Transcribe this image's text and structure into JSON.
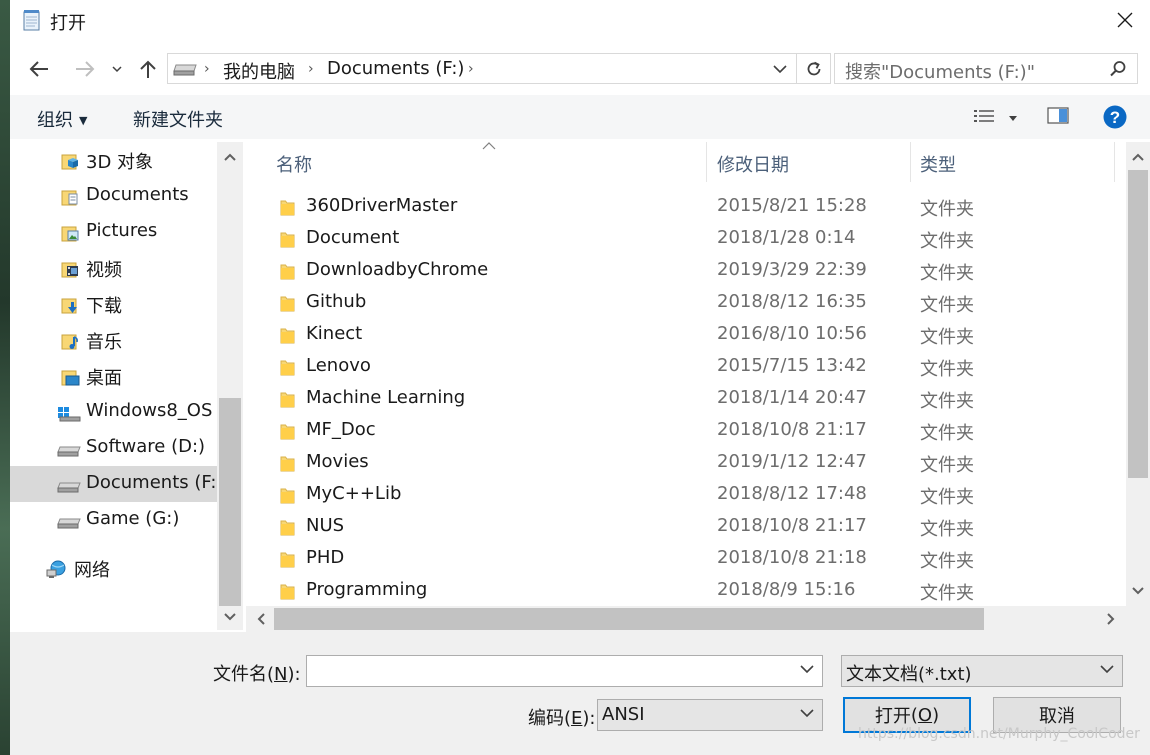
{
  "window": {
    "title": "打开"
  },
  "address": {
    "crumbs": [
      "我的电脑",
      "Documents (F:)"
    ],
    "search_placeholder": "搜索\"Documents (F:)\""
  },
  "toolbar": {
    "organize": "组织",
    "new_folder": "新建文件夹"
  },
  "nav": {
    "items": [
      {
        "label": "3D 对象",
        "icon": "3d-objects-icon"
      },
      {
        "label": "Documents",
        "icon": "documents-folder-icon"
      },
      {
        "label": "Pictures",
        "icon": "pictures-folder-icon"
      },
      {
        "label": "视频",
        "icon": "videos-folder-icon"
      },
      {
        "label": "下载",
        "icon": "downloads-folder-icon"
      },
      {
        "label": "音乐",
        "icon": "music-folder-icon"
      },
      {
        "label": "桌面",
        "icon": "desktop-folder-icon"
      },
      {
        "label": "Windows8_OS (",
        "icon": "windows-drive-icon"
      },
      {
        "label": "Software (D:)",
        "icon": "drive-icon"
      },
      {
        "label": "Documents (F:)",
        "icon": "drive-icon",
        "selected": true
      },
      {
        "label": "Game (G:)",
        "icon": "drive-icon"
      },
      {
        "label": "网络",
        "icon": "network-icon"
      }
    ]
  },
  "columns": {
    "name": "名称",
    "modified": "修改日期",
    "type": "类型"
  },
  "files": [
    {
      "name": "360DriverMaster",
      "date": "2015/8/21 15:28",
      "type": "文件夹"
    },
    {
      "name": "Document",
      "date": "2018/1/28 0:14",
      "type": "文件夹"
    },
    {
      "name": "DownloadbyChrome",
      "date": "2019/3/29 22:39",
      "type": "文件夹"
    },
    {
      "name": "Github",
      "date": "2018/8/12 16:35",
      "type": "文件夹"
    },
    {
      "name": "Kinect",
      "date": "2016/8/10 10:56",
      "type": "文件夹"
    },
    {
      "name": "Lenovo",
      "date": "2015/7/15 13:42",
      "type": "文件夹"
    },
    {
      "name": "Machine Learning",
      "date": "2018/1/14 20:47",
      "type": "文件夹"
    },
    {
      "name": "MF_Doc",
      "date": "2018/10/8 21:17",
      "type": "文件夹"
    },
    {
      "name": "Movies",
      "date": "2019/1/12 12:47",
      "type": "文件夹"
    },
    {
      "name": "MyC++Lib",
      "date": "2018/8/12 17:48",
      "type": "文件夹"
    },
    {
      "name": "NUS",
      "date": "2018/10/8 21:17",
      "type": "文件夹"
    },
    {
      "name": "PHD",
      "date": "2018/10/8 21:18",
      "type": "文件夹"
    },
    {
      "name": "Programming",
      "date": "2018/8/9 15:16",
      "type": "文件夹"
    }
  ],
  "bottom": {
    "filename_label": "文件名",
    "filename_key": "N",
    "filename_value": "",
    "filter_value": "文本文档(*.txt)",
    "encoding_label": "编码",
    "encoding_key": "E",
    "encoding_value": "ANSI",
    "open_label": "打开",
    "open_key": "O",
    "cancel_label": "取消"
  },
  "watermark": "https://blog.csdn.net/Murphy_CoolCoder",
  "colors": {
    "accent": "#0078d7",
    "folder": "#f8d775",
    "selected": "#d9d9d9"
  }
}
